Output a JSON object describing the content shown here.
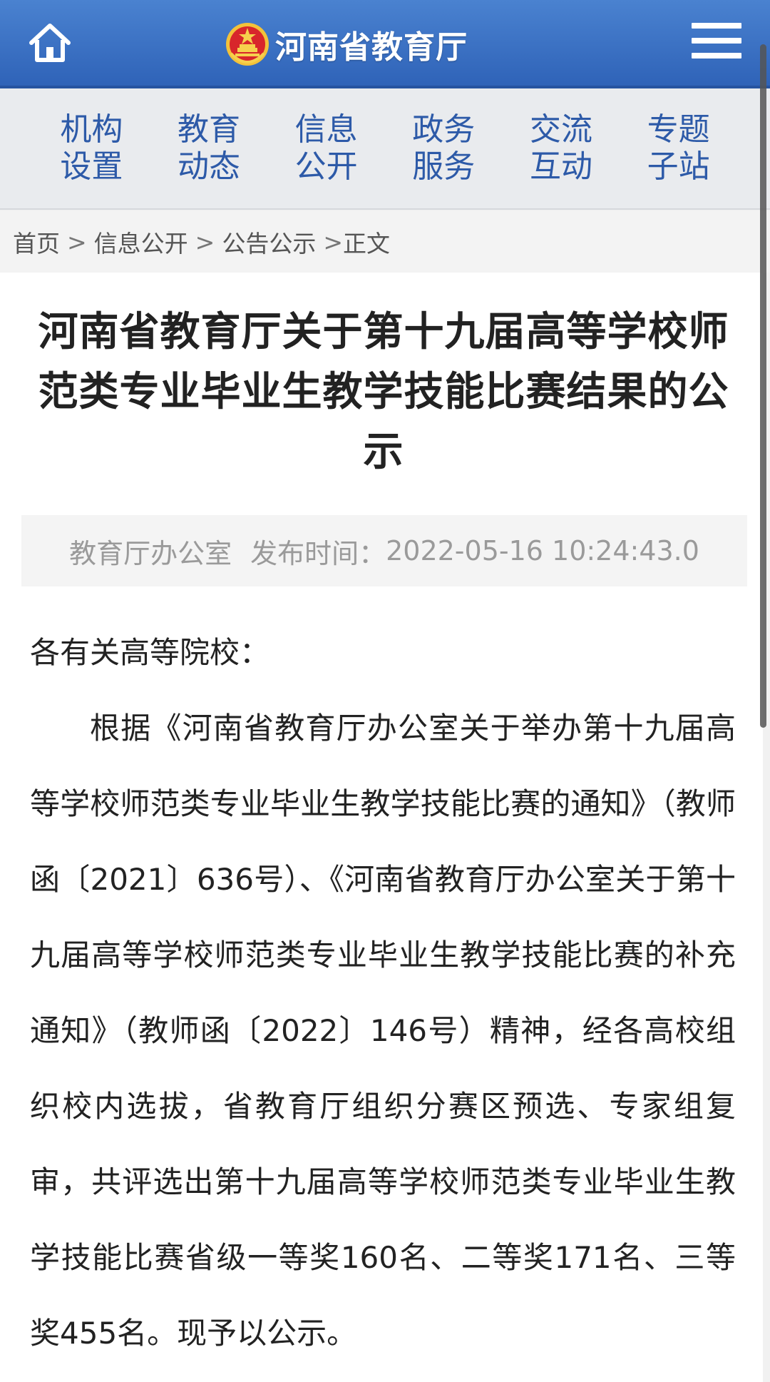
{
  "header": {
    "title": "河南省教育厅",
    "home_icon": "home-icon",
    "emblem_icon": "national-emblem-icon",
    "menu_icon": "hamburger-menu-icon",
    "colors": {
      "bar": "#3a6fc4",
      "text": "#ffffff"
    }
  },
  "nav": {
    "items": [
      {
        "line1": "机构",
        "line2": "设置"
      },
      {
        "line1": "教育",
        "line2": "动态"
      },
      {
        "line1": "信息",
        "line2": "公开"
      },
      {
        "line1": "政务",
        "line2": "服务"
      },
      {
        "line1": "交流",
        "line2": "互动"
      },
      {
        "line1": "专题",
        "line2": "子站"
      }
    ],
    "color": "#2d5aa8"
  },
  "breadcrumb": {
    "items": [
      "首页",
      "信息公开",
      "公告公示"
    ],
    "current": "正文",
    "separator": ">"
  },
  "article": {
    "title": "河南省教育厅关于第十九届高等学校师范类专业毕业生教学技能比赛结果的公示",
    "source": "教育厅办公室",
    "publish_label": "发布时间：",
    "publish_time": "2022-05-16 10:24:43.0",
    "salutation": "各有关高等院校：",
    "paragraph": "根据《河南省教育厅办公室关于举办第十九届高等学校师范类专业毕业生教学技能比赛的通知》（教师函〔2021〕636号）、《河南省教育厅办公室关于第十九届高等学校师范类专业毕业生教学技能比赛的补充通知》（教师函〔2022〕146号）精神，经各高校组织校内选拔，省教育厅组织分赛区预选、专家组复审，共评选出第十九届高等学校师范类专业毕业生教学技能比赛省级一等奖160名、二等奖171名、三等奖455名。现予以公示。"
  }
}
